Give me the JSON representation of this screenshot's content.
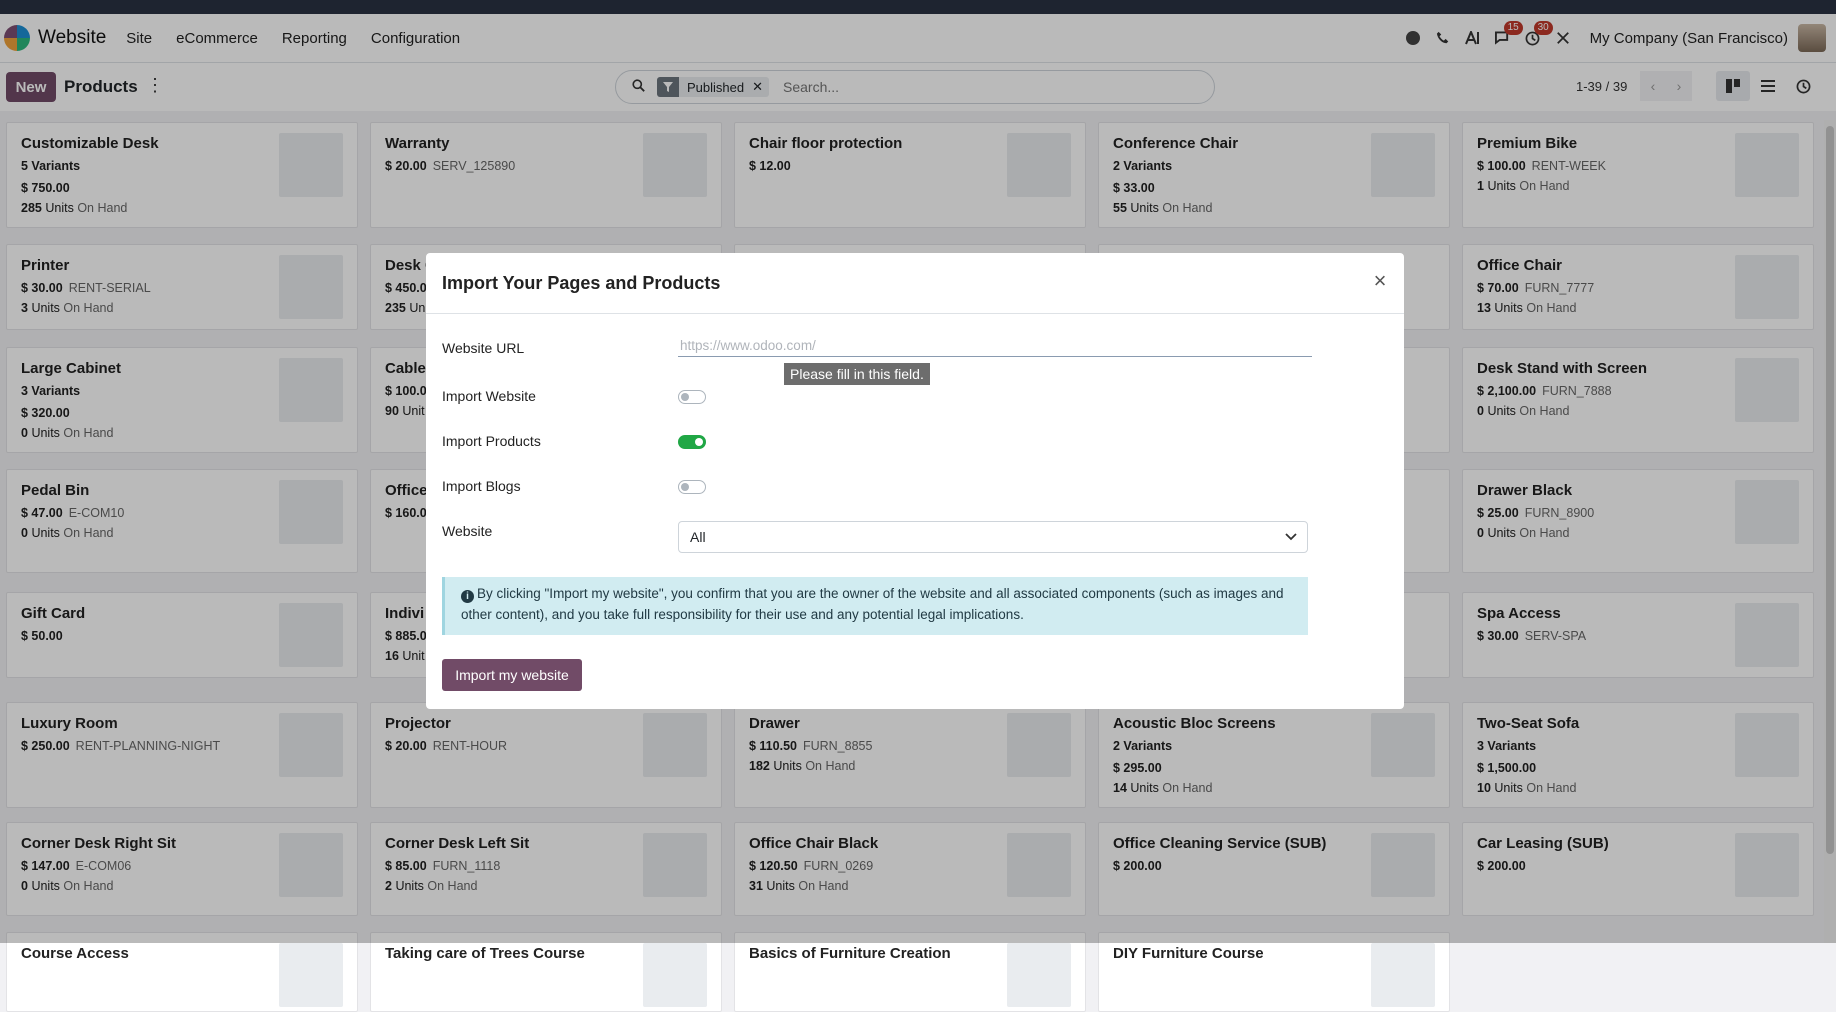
{
  "navbar": {
    "app_name": "Website",
    "menu": [
      "Site",
      "eCommerce",
      "Reporting",
      "Configuration"
    ],
    "chat_badge": "15",
    "activity_badge": "30",
    "company": "My Company (San Francisco)"
  },
  "control": {
    "new_label": "New",
    "title": "Products",
    "kebab": "⋮",
    "facet": "Published",
    "facet_remove": "✕",
    "search_placeholder": "Search...",
    "pager": "1-39 / 39",
    "prev": "‹",
    "next": "›"
  },
  "products": [
    {
      "name": "Customizable Desk",
      "l1": "5 Variants",
      "price": "$ 750.00",
      "qty": "285",
      "unit": "Units",
      "onhand": "On Hand"
    },
    {
      "name": "Warranty",
      "price": "$ 20.00",
      "ref": "SERV_125890"
    },
    {
      "name": "Chair floor protection",
      "price": "$ 12.00"
    },
    {
      "name": "Conference Chair",
      "l1": "2 Variants",
      "price": "$ 33.00",
      "qty": "55",
      "unit": "Units",
      "onhand": "On Hand"
    },
    {
      "name": "Premium Bike",
      "price": "$ 100.00",
      "ref": "RENT-WEEK",
      "qty": "1",
      "unit": "Units",
      "onhand": "On Hand"
    },
    {
      "name": "Printer",
      "price": "$ 30.00",
      "ref": "RENT-SERIAL",
      "qty": "3",
      "unit": "Units",
      "onhand": "On Hand"
    },
    {
      "name": "Desk C",
      "price": "$ 450.0",
      "qty": "235",
      "unit": "Un"
    },
    {
      "name": "",
      "price": ""
    },
    {
      "name": "",
      "price": ""
    },
    {
      "name": "Office Chair",
      "price": "$ 70.00",
      "ref": "FURN_7777",
      "qty": "13",
      "unit": "Units",
      "onhand": "On Hand"
    },
    {
      "name": "Large Cabinet",
      "l1": "3 Variants",
      "price": "$ 320.00",
      "qty": "0",
      "unit": "Units",
      "onhand": "On Hand"
    },
    {
      "name": "Cable",
      "price": "$ 100.0",
      "qty": "90",
      "unit": "Unit"
    },
    {
      "name": "",
      "price": ""
    },
    {
      "name": "",
      "price": ""
    },
    {
      "name": "Desk Stand with Screen",
      "price": "$ 2,100.00",
      "ref": "FURN_7888",
      "qty": "0",
      "unit": "Units",
      "onhand": "On Hand"
    },
    {
      "name": "Pedal Bin",
      "price": "$ 47.00",
      "ref": "E-COM10",
      "qty": "0",
      "unit": "Units",
      "onhand": "On Hand"
    },
    {
      "name": "Office",
      "price": "$ 160.0"
    },
    {
      "name": "",
      "price": ""
    },
    {
      "name": "",
      "price": ""
    },
    {
      "name": "Drawer Black",
      "price": "$ 25.00",
      "ref": "FURN_8900",
      "qty": "0",
      "unit": "Units",
      "onhand": "On Hand"
    },
    {
      "name": "Gift Card",
      "price": "$ 50.00"
    },
    {
      "name": "Indivi",
      "price": "$ 885.0",
      "qty": "16",
      "unit": "Unit"
    },
    {
      "name": "",
      "price": ""
    },
    {
      "name": "",
      "price": ""
    },
    {
      "name": "Spa Access",
      "price": "$ 30.00",
      "ref": "SERV-SPA"
    },
    {
      "name": "Luxury Room",
      "price": "$ 250.00",
      "ref": "RENT-PLANNING-NIGHT"
    },
    {
      "name": "Projector",
      "price": "$ 20.00",
      "ref": "RENT-HOUR"
    },
    {
      "name": "Drawer",
      "price": "$ 110.50",
      "ref": "FURN_8855",
      "qty": "182",
      "unit": "Units",
      "onhand": "On Hand"
    },
    {
      "name": "Acoustic Bloc Screens",
      "l1": "2 Variants",
      "price": "$ 295.00",
      "qty": "14",
      "unit": "Units",
      "onhand": "On Hand"
    },
    {
      "name": "Two-Seat Sofa",
      "l1": "3 Variants",
      "price": "$ 1,500.00",
      "qty": "10",
      "unit": "Units",
      "onhand": "On Hand"
    },
    {
      "name": "Corner Desk Right Sit",
      "price": "$ 147.00",
      "ref": "E-COM06",
      "qty": "0",
      "unit": "Units",
      "onhand": "On Hand"
    },
    {
      "name": "Corner Desk Left Sit",
      "price": "$ 85.00",
      "ref": "FURN_1118",
      "qty": "2",
      "unit": "Units",
      "onhand": "On Hand"
    },
    {
      "name": "Office Chair Black",
      "price": "$ 120.50",
      "ref": "FURN_0269",
      "qty": "31",
      "unit": "Units",
      "onhand": "On Hand"
    },
    {
      "name": "Office Cleaning Service (SUB)",
      "price": "$ 200.00"
    },
    {
      "name": "Car Leasing (SUB)",
      "price": "$ 200.00"
    },
    {
      "name": "Course Access",
      "price": ""
    },
    {
      "name": "Taking care of Trees Course",
      "price": ""
    },
    {
      "name": "Basics of Furniture Creation",
      "price": ""
    },
    {
      "name": "DIY Furniture Course",
      "price": ""
    }
  ],
  "modal": {
    "title": "Import Your Pages and Products",
    "close": "×",
    "url_label": "Website URL",
    "url_placeholder": "https://www.odoo.com/",
    "tooltip": "Please fill in this field.",
    "import_website_label": "Import Website",
    "import_website": false,
    "import_products_label": "Import Products",
    "import_products": true,
    "import_blogs_label": "Import Blogs",
    "import_blogs": false,
    "website_label": "Website",
    "website_value": "All",
    "notice": "By clicking \"Import my website\", you confirm that you are the owner of the website and all associated components (such as images and other content), and you take full responsibility for their use and any potential legal implications.",
    "import_button": "Import my website"
  },
  "colors": {
    "brand": "#714b67",
    "toggle_on": "#20a745",
    "alert_bg": "#d1ecf1"
  }
}
